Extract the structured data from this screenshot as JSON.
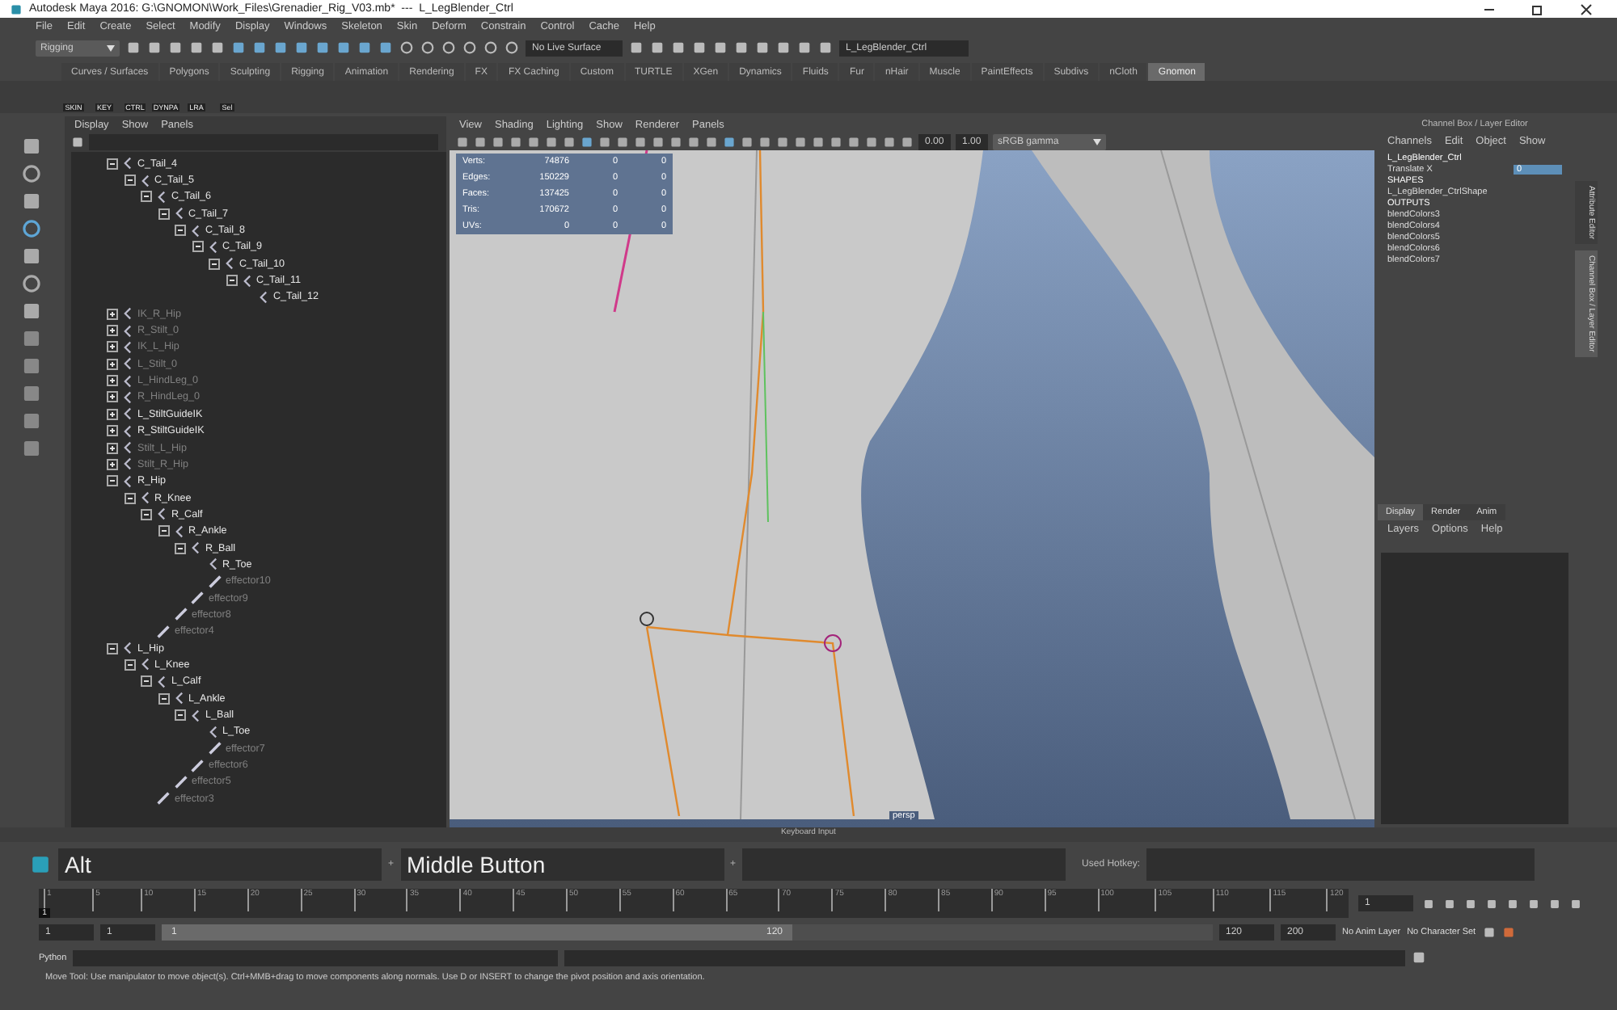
{
  "window": {
    "title": "Autodesk Maya 2016: G:\\GNOMON\\Work_Files\\Grenadier_Rig_V03.mb*  ---  L_LegBlender_Ctrl"
  },
  "menu": [
    "File",
    "Edit",
    "Create",
    "Select",
    "Modify",
    "Display",
    "Windows",
    "Skeleton",
    "Skin",
    "Deform",
    "Constrain",
    "Control",
    "Cache",
    "Help"
  ],
  "status_line": {
    "mode": "Rigging",
    "live_surface": "No Live Surface",
    "selection_field": "L_LegBlender_Ctrl"
  },
  "shelf_tabs": [
    {
      "label": "Curves / Surfaces",
      "selected": false
    },
    {
      "label": "Polygons",
      "selected": false
    },
    {
      "label": "Sculpting",
      "selected": false
    },
    {
      "label": "Rigging",
      "selected": false
    },
    {
      "label": "Animation",
      "selected": false
    },
    {
      "label": "Rendering",
      "selected": false
    },
    {
      "label": "FX",
      "selected": false
    },
    {
      "label": "FX Caching",
      "selected": false
    },
    {
      "label": "Custom",
      "selected": false
    },
    {
      "label": "TURTLE",
      "selected": false
    },
    {
      "label": "XGen",
      "selected": false
    },
    {
      "label": "Dynamics",
      "selected": false
    },
    {
      "label": "Fluids",
      "selected": false
    },
    {
      "label": "Fur",
      "selected": false
    },
    {
      "label": "nHair",
      "selected": false
    },
    {
      "label": "Muscle",
      "selected": false
    },
    {
      "label": "PaintEffects",
      "selected": false
    },
    {
      "label": "Subdivs",
      "selected": false
    },
    {
      "label": "nCloth",
      "selected": false
    },
    {
      "label": "Gnomon",
      "selected": true
    }
  ],
  "shelf_buttons": [
    {
      "label": "SKIN",
      "kind": "script"
    },
    {
      "label": "KEY",
      "kind": "script"
    },
    {
      "label": "CTRL",
      "kind": "script"
    },
    {
      "label": "DYNPA",
      "kind": "script"
    },
    {
      "label": "LRA",
      "kind": "script"
    },
    {
      "label": "Sel",
      "kind": "script"
    }
  ],
  "outliner": {
    "menu": [
      "Display",
      "Show",
      "Panels"
    ],
    "tree": [
      {
        "name": "C_Tail_4",
        "kind": "joint",
        "dimmed": false,
        "expanded": true,
        "children": [
          {
            "name": "C_Tail_5",
            "kind": "joint",
            "dimmed": false,
            "expanded": true,
            "children": [
              {
                "name": "C_Tail_6",
                "kind": "joint",
                "dimmed": false,
                "expanded": true,
                "children": [
                  {
                    "name": "C_Tail_7",
                    "kind": "joint",
                    "dimmed": false,
                    "expanded": true,
                    "children": [
                      {
                        "name": "C_Tail_8",
                        "kind": "joint",
                        "dimmed": false,
                        "expanded": true,
                        "children": [
                          {
                            "name": "C_Tail_9",
                            "kind": "joint",
                            "dimmed": false,
                            "expanded": true,
                            "children": [
                              {
                                "name": "C_Tail_10",
                                "kind": "joint",
                                "dimmed": false,
                                "expanded": true,
                                "children": [
                                  {
                                    "name": "C_Tail_11",
                                    "kind": "joint",
                                    "dimmed": false,
                                    "expanded": true,
                                    "children": [
                                      {
                                        "name": "C_Tail_12",
                                        "kind": "joint",
                                        "dimmed": false
                                      }
                                    ]
                                  }
                                ]
                              }
                            ]
                          }
                        ]
                      }
                    ]
                  }
                ]
              }
            ]
          }
        ]
      },
      {
        "name": "IK_R_Hip",
        "kind": "joint",
        "dimmed": true,
        "expanded": false
      },
      {
        "name": "R_Stilt_0",
        "kind": "joint",
        "dimmed": true,
        "expanded": false
      },
      {
        "name": "IK_L_Hip",
        "kind": "joint",
        "dimmed": true,
        "expanded": false
      },
      {
        "name": "L_Stilt_0",
        "kind": "joint",
        "dimmed": true,
        "expanded": false
      },
      {
        "name": "L_HindLeg_0",
        "kind": "joint",
        "dimmed": true,
        "expanded": false
      },
      {
        "name": "R_HindLeg_0",
        "kind": "joint",
        "dimmed": true,
        "expanded": false
      },
      {
        "name": "L_StiltGuideIK",
        "kind": "joint",
        "dimmed": false,
        "expanded": false
      },
      {
        "name": "R_StiltGuideIK",
        "kind": "joint",
        "dimmed": false,
        "expanded": false
      },
      {
        "name": "Stilt_L_Hip",
        "kind": "joint",
        "dimmed": true,
        "expanded": false
      },
      {
        "name": "Stilt_R_Hip",
        "kind": "joint",
        "dimmed": true,
        "expanded": false
      },
      {
        "name": "R_Hip",
        "kind": "joint",
        "dimmed": false,
        "expanded": true,
        "children": [
          {
            "name": "R_Knee",
            "kind": "joint",
            "dimmed": false,
            "expanded": true,
            "children": [
              {
                "name": "R_Calf",
                "kind": "joint",
                "dimmed": false,
                "expanded": true,
                "children": [
                  {
                    "name": "R_Ankle",
                    "kind": "joint",
                    "dimmed": false,
                    "expanded": true,
                    "children": [
                      {
                        "name": "R_Ball",
                        "kind": "joint",
                        "dimmed": false,
                        "expanded": true,
                        "children": [
                          {
                            "name": "R_Toe",
                            "kind": "joint",
                            "dimmed": false
                          },
                          {
                            "name": "effector10",
                            "kind": "effector",
                            "dimmed": true
                          }
                        ]
                      },
                      {
                        "name": "effector9",
                        "kind": "effector",
                        "dimmed": true
                      }
                    ]
                  },
                  {
                    "name": "effector8",
                    "kind": "effector",
                    "dimmed": true
                  }
                ]
              },
              {
                "name": "effector4",
                "kind": "effector",
                "dimmed": true
              }
            ]
          }
        ]
      },
      {
        "name": "L_Hip",
        "kind": "joint",
        "dimmed": false,
        "expanded": true,
        "children": [
          {
            "name": "L_Knee",
            "kind": "joint",
            "dimmed": false,
            "expanded": true,
            "children": [
              {
                "name": "L_Calf",
                "kind": "joint",
                "dimmed": false,
                "expanded": true,
                "children": [
                  {
                    "name": "L_Ankle",
                    "kind": "joint",
                    "dimmed": false,
                    "expanded": true,
                    "children": [
                      {
                        "name": "L_Ball",
                        "kind": "joint",
                        "dimmed": false,
                        "expanded": true,
                        "children": [
                          {
                            "name": "L_Toe",
                            "kind": "joint",
                            "dimmed": false
                          },
                          {
                            "name": "effector7",
                            "kind": "effector",
                            "dimmed": true
                          }
                        ]
                      },
                      {
                        "name": "effector6",
                        "kind": "effector",
                        "dimmed": true
                      }
                    ]
                  },
                  {
                    "name": "effector5",
                    "kind": "effector",
                    "dimmed": true
                  }
                ]
              },
              {
                "name": "effector3",
                "kind": "effector",
                "dimmed": true
              }
            ]
          }
        ]
      }
    ]
  },
  "viewport": {
    "menu": [
      "View",
      "Shading",
      "Lighting",
      "Show",
      "Renderer",
      "Panels"
    ],
    "exposure": "0.00",
    "gamma": "1.00",
    "color_space": "sRGB gamma",
    "camera": "persp",
    "stats": [
      {
        "label": "Verts:",
        "values": [
          "74876",
          "0",
          "0"
        ]
      },
      {
        "label": "Edges:",
        "values": [
          "150229",
          "0",
          "0"
        ]
      },
      {
        "label": "Faces:",
        "values": [
          "137425",
          "0",
          "0"
        ]
      },
      {
        "label": "Tris:",
        "values": [
          "170672",
          "0",
          "0"
        ]
      },
      {
        "label": "UVs:",
        "values": [
          "0",
          "0",
          "0"
        ]
      }
    ]
  },
  "channel_box": {
    "title": "Channel Box / Layer Editor",
    "menu": [
      "Channels",
      "Edit",
      "Object",
      "Show"
    ],
    "node": "L_LegBlender_Ctrl",
    "attributes": [
      {
        "label": "Translate X",
        "value": "0"
      }
    ],
    "shapes_heading": "SHAPES",
    "shapes": [
      "L_LegBlender_CtrlShape"
    ],
    "outputs_heading": "OUTPUTS",
    "outputs": [
      "blendColors3",
      "blendColors4",
      "blendColors5",
      "blendColors6",
      "blendColors7"
    ],
    "layer_tabs": [
      {
        "label": "Display",
        "selected": true
      },
      {
        "label": "Render",
        "selected": false
      },
      {
        "label": "Anim",
        "selected": false
      }
    ],
    "layer_menu": [
      "Layers",
      "Options",
      "Help"
    ]
  },
  "side_tabs": [
    {
      "label": "Attribute Editor",
      "selected": false
    },
    {
      "label": "Channel Box / Layer Editor",
      "selected": true
    }
  ],
  "keyboard_input": {
    "title": "Keyboard Input",
    "keys": [
      "Alt",
      "Middle Button"
    ],
    "separators": [
      "+",
      "+"
    ],
    "hotkey_label": "Used Hotkey:"
  },
  "time_slider": {
    "ticks": [
      "1",
      "5",
      "10",
      "15",
      "20",
      "25",
      "30",
      "35",
      "40",
      "45",
      "50",
      "55",
      "60",
      "65",
      "70",
      "75",
      "80",
      "85",
      "90",
      "95",
      "100",
      "105",
      "110",
      "115",
      "120"
    ],
    "current_frame": "1",
    "marker_label": "1",
    "level": 0
  },
  "range_slider": {
    "start": "1",
    "playback_start": "1",
    "range_start": "1",
    "range_end": "120",
    "level": 0.6,
    "playback_end": "120",
    "end": "200",
    "anim_layer": "No Anim Layer",
    "character_set": "No Character Set"
  },
  "command_line": {
    "language": "Python"
  },
  "help_line": "Move Tool: Use manipulator to move object(s). Ctrl+MMB+drag to move components along normals. Use D or INSERT to change the pivot position and axis orientation."
}
